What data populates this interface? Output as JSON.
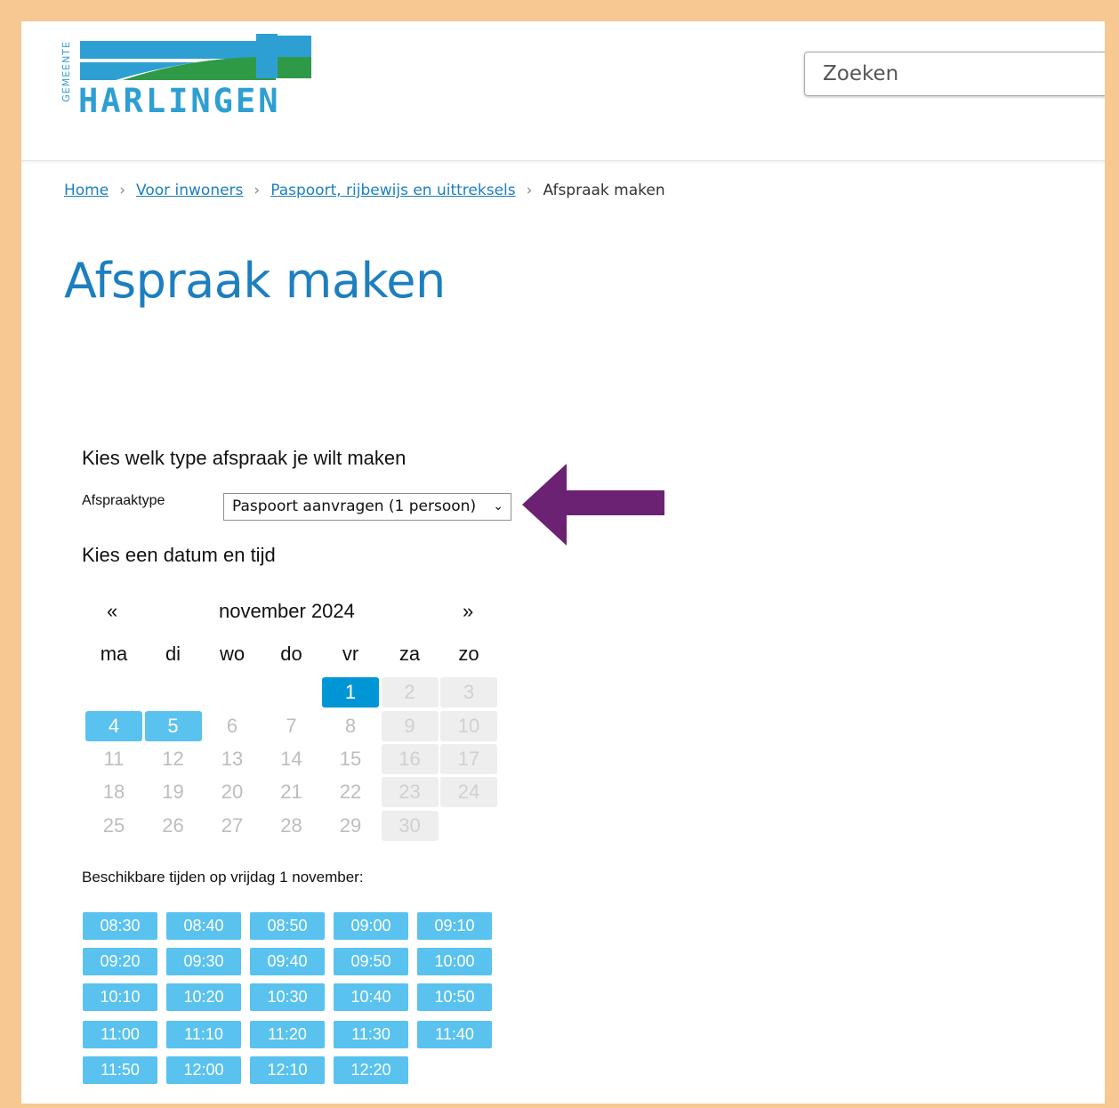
{
  "header": {
    "logo": {
      "vertical_text": "GEMEENTE",
      "name": "HARLINGEN"
    },
    "search_placeholder": "Zoeken"
  },
  "breadcrumb": [
    {
      "label": "Home",
      "link": true
    },
    {
      "label": "Voor inwoners",
      "link": true
    },
    {
      "label": "Paspoort, rijbewijs en uittreksels",
      "link": true
    },
    {
      "label": "Afspraak maken",
      "link": false
    }
  ],
  "page_title": "Afspraak maken",
  "type_section": {
    "heading": "Kies welk type afspraak je wilt maken",
    "label": "Afspraaktype",
    "selected": "Paspoort aanvragen (1 persoon)"
  },
  "date_section": {
    "heading": "Kies een datum en tijd"
  },
  "calendar": {
    "prev": "«",
    "next": "»",
    "month": "november 2024",
    "weekdays": [
      "ma",
      "di",
      "wo",
      "do",
      "vr",
      "za",
      "zo"
    ],
    "weeks": [
      [
        null,
        null,
        null,
        null,
        {
          "d": "1",
          "s": "sel"
        },
        {
          "d": "2",
          "s": "weekend"
        },
        {
          "d": "3",
          "s": "weekend"
        }
      ],
      [
        {
          "d": "4",
          "s": "avail"
        },
        {
          "d": "5",
          "s": "avail"
        },
        {
          "d": "6",
          "s": "off"
        },
        {
          "d": "7",
          "s": "off"
        },
        {
          "d": "8",
          "s": "off"
        },
        {
          "d": "9",
          "s": "weekend"
        },
        {
          "d": "10",
          "s": "weekend"
        }
      ],
      [
        {
          "d": "11",
          "s": "off"
        },
        {
          "d": "12",
          "s": "off"
        },
        {
          "d": "13",
          "s": "off"
        },
        {
          "d": "14",
          "s": "off"
        },
        {
          "d": "15",
          "s": "off"
        },
        {
          "d": "16",
          "s": "weekend"
        },
        {
          "d": "17",
          "s": "weekend"
        }
      ],
      [
        {
          "d": "18",
          "s": "off"
        },
        {
          "d": "19",
          "s": "off"
        },
        {
          "d": "20",
          "s": "off"
        },
        {
          "d": "21",
          "s": "off"
        },
        {
          "d": "22",
          "s": "off"
        },
        {
          "d": "23",
          "s": "weekend"
        },
        {
          "d": "24",
          "s": "weekend"
        }
      ],
      [
        {
          "d": "25",
          "s": "off"
        },
        {
          "d": "26",
          "s": "off"
        },
        {
          "d": "27",
          "s": "off"
        },
        {
          "d": "28",
          "s": "off"
        },
        {
          "d": "29",
          "s": "off"
        },
        {
          "d": "30",
          "s": "weekend"
        },
        null
      ]
    ]
  },
  "times": {
    "label": "Beschikbare tijden op vrijdag 1 november:",
    "slots": [
      "08:30",
      "08:40",
      "08:50",
      "09:00",
      "09:10",
      "09:20",
      "09:30",
      "09:40",
      "09:50",
      "10:00",
      "10:10",
      "10:20",
      "10:30",
      "10:40",
      "10:50",
      "11:00",
      "11:10",
      "11:20",
      "11:30",
      "11:40",
      "11:50",
      "12:00",
      "12:10",
      "12:20"
    ]
  },
  "colors": {
    "frame": "#f7c892",
    "brand_blue": "#2e9fd3",
    "brand_green": "#2e9a47",
    "link": "#1d7fbf",
    "selected_day": "#0096d6",
    "available": "#59c2ee",
    "arrow": "#6b2273"
  }
}
